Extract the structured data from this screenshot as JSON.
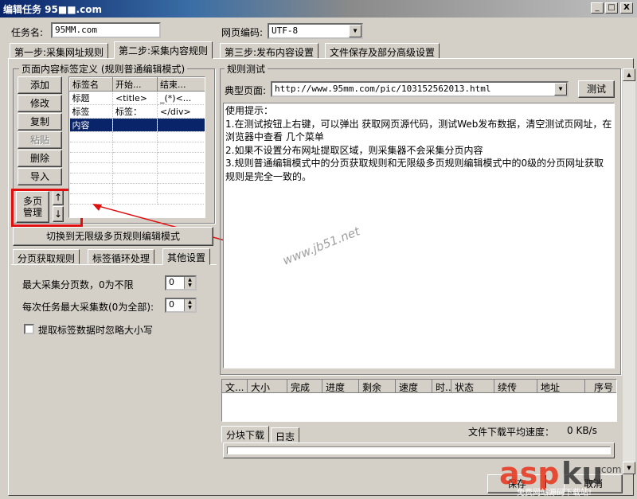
{
  "window": {
    "title": "编辑任务  95■■.com",
    "min": "_",
    "max": "□",
    "close": "X"
  },
  "task": {
    "name_label": "任务名:",
    "name_value": "95MM.com",
    "encoding_label": "网页编码:",
    "encoding_value": "UTF-8"
  },
  "tabs": [
    "第一步:采集网址规则",
    "第二步:采集内容规则",
    "第三步:发布内容设置",
    "文件保存及部分高级设置"
  ],
  "left": {
    "group_title": "页面内容标签定义 (规则普通编辑模式)",
    "buttons": {
      "add": "添加",
      "edit": "修改",
      "copy": "复制",
      "paste": "粘贴",
      "delete": "删除",
      "import": "导入",
      "multipage": "多页\n管理",
      "up": "↑",
      "down": "↓"
    },
    "grid_headers": [
      "标签名",
      "开始...",
      "结束..."
    ],
    "grid_rows": [
      [
        "标题",
        "<title>",
        "_(*)<..."
      ],
      [
        "标签",
        "标签：",
        "</div>"
      ],
      [
        "内容",
        "",
        ""
      ]
    ],
    "switch_button": "切换到无限级多页规则编辑模式",
    "subtabs": [
      "分页获取规则",
      "标签循环处理",
      "其他设置"
    ],
    "max_pages_label": "最大采集分页数，0为不限",
    "max_pages_value": "0",
    "max_per_task_label": "每次任务最大采集数(0为全部):",
    "max_per_task_value": "0",
    "ignore_case_label": "提取标签数据时忽略大小写"
  },
  "right": {
    "group_title": "规则测试",
    "typical_label": "典型页面:",
    "typical_url": "http://www.95mm.com/pic/103152562013.html",
    "test_button": "测试",
    "hint_lines": [
      "使用提示：",
      "1.在测试按钮上右键，可以弹出 获取网页源代码，测试Web发布数据，清空测试页网址，在",
      "浏览器中查看 几个菜单",
      "2.如果不设置分布网址提取区域，则采集器不会采集分页内容",
      "3.规则普通编辑模式中的分页获取规则和无限级多页规则编辑模式中的0级的分页网址获取",
      "规则是完全一致的。"
    ],
    "download_headers": [
      "文...",
      "大小",
      "完成",
      "进度",
      "剩余",
      "速度",
      "时...",
      "状态",
      "续传",
      "地址",
      "序号"
    ],
    "bottom_tabs": [
      "分块下载",
      "日志"
    ],
    "avg_speed_label": "文件下载平均速度：",
    "avg_speed_value": "0 KB/s"
  },
  "footer": {
    "save": "保存",
    "cancel": "取消"
  },
  "watermark": "www.jb51.net",
  "accent": {
    "highlight_red": "#e01010",
    "selection_blue": "#0a246a"
  }
}
